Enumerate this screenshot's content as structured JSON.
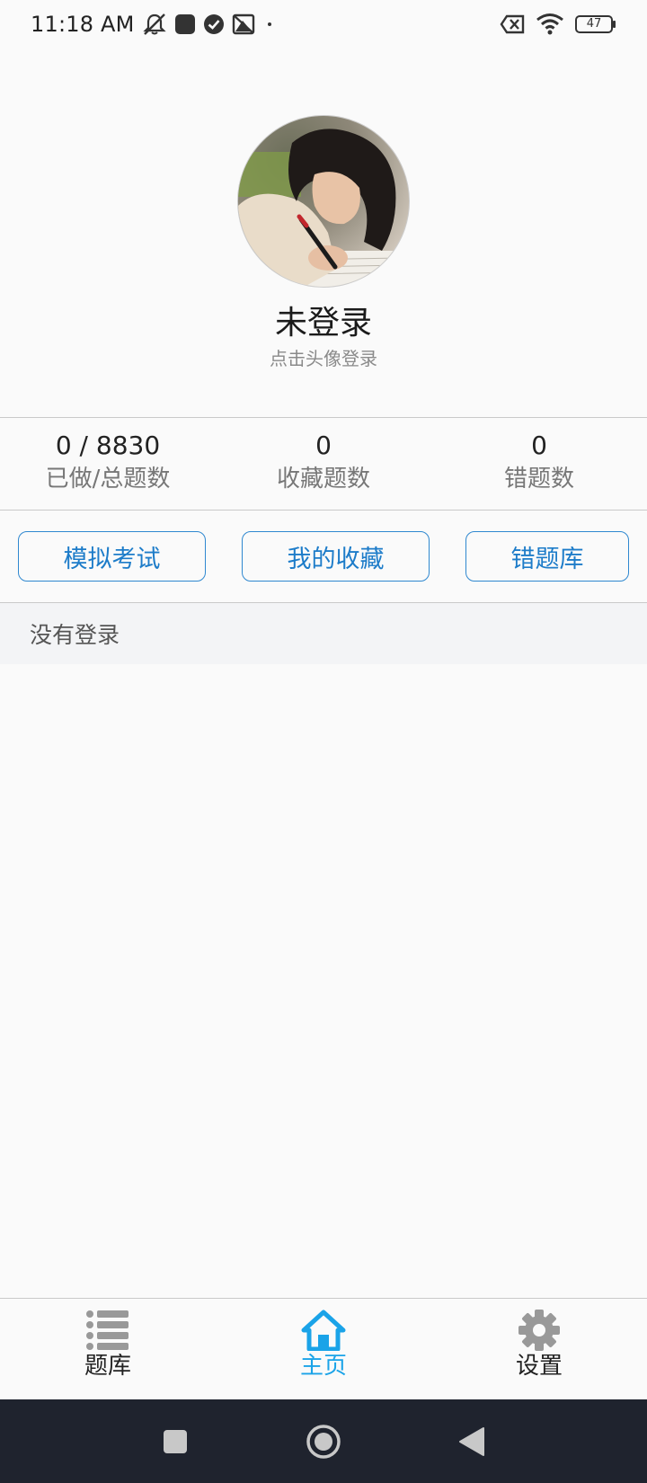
{
  "status_bar": {
    "time": "11:18 AM",
    "battery": "47"
  },
  "profile": {
    "name": "未登录",
    "hint": "点击头像登录"
  },
  "stats": [
    {
      "value": "0 / 8830",
      "label": "已做/总题数"
    },
    {
      "value": "0",
      "label": "收藏题数"
    },
    {
      "value": "0",
      "label": "错题数"
    }
  ],
  "actions": {
    "mock_exam": "模拟考试",
    "my_favorites": "我的收藏",
    "wrong_bank": "错题库"
  },
  "notice": "没有登录",
  "bottom_nav": {
    "items": [
      {
        "label": "题库",
        "icon": "list-icon",
        "active": false
      },
      {
        "label": "主页",
        "icon": "home-icon",
        "active": true
      },
      {
        "label": "设置",
        "icon": "gear-icon",
        "active": false
      }
    ],
    "active_color": "#1aa3e8",
    "inactive_color": "#999999"
  },
  "colors": {
    "accent": "#1d7cc9",
    "background": "#fafafa",
    "system_nav": "#1f232e"
  }
}
